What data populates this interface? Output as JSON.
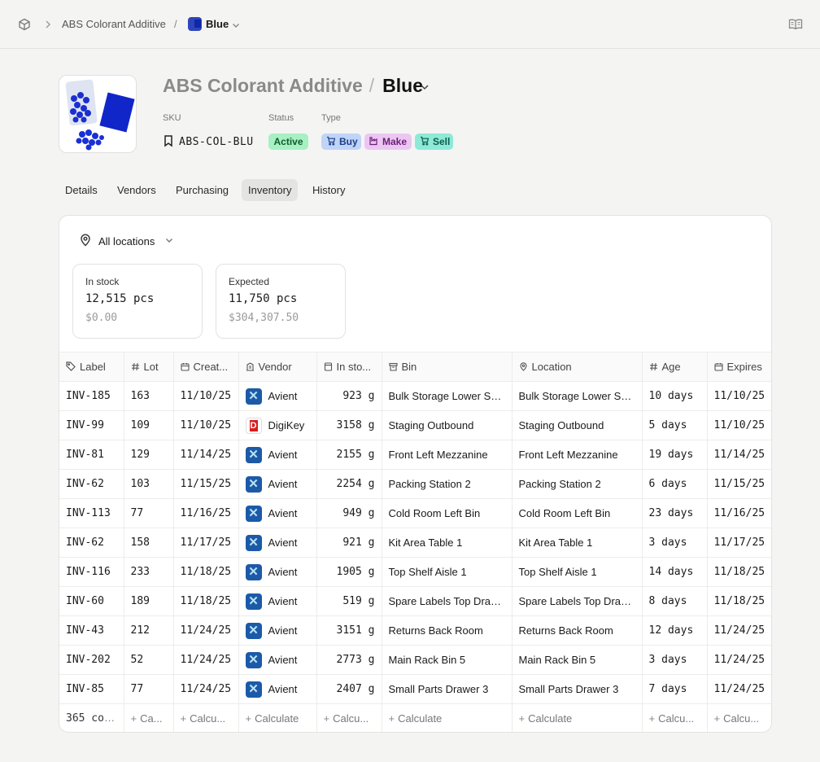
{
  "breadcrumb": {
    "item": "ABS Colorant Additive",
    "separator": "/",
    "variant": "Blue"
  },
  "header": {
    "parent_title": "ABS Colorant Additive",
    "separator": "/",
    "variant_title": "Blue",
    "sku_label": "SKU",
    "sku": "ABS-COL-BLU",
    "status_label": "Status",
    "status": "Active",
    "type_label": "Type",
    "types": [
      "Buy",
      "Make",
      "Sell"
    ]
  },
  "tabs": [
    "Details",
    "Vendors",
    "Purchasing",
    "Inventory",
    "History"
  ],
  "active_tab": "Inventory",
  "location_filter": "All locations",
  "stats": {
    "in_stock": {
      "label": "In stock",
      "qty": "12,515 pcs",
      "value": "$0.00"
    },
    "expected": {
      "label": "Expected",
      "qty": "11,750 pcs",
      "value": "$304,307.50"
    }
  },
  "table": {
    "columns": [
      "Label",
      "Lot",
      "Creat...",
      "Vendor",
      "In sto...",
      "Bin",
      "Location",
      "Age",
      "Expires"
    ],
    "rows": [
      [
        "INV-185",
        "163",
        "11/10/25",
        "Avient",
        "923 g",
        "Bulk Storage Lower Shelf",
        "Bulk Storage Lower Shelf",
        "10 days",
        "11/10/25"
      ],
      [
        "INV-99",
        "109",
        "11/10/25",
        "DigiKey",
        "3158 g",
        "Staging Outbound",
        "Staging Outbound",
        "5 days",
        "11/10/25"
      ],
      [
        "INV-81",
        "129",
        "11/14/25",
        "Avient",
        "2155 g",
        "Front Left Mezzanine",
        "Front Left Mezzanine",
        "19 days",
        "11/14/25"
      ],
      [
        "INV-62",
        "103",
        "11/15/25",
        "Avient",
        "2254 g",
        "Packing Station 2",
        "Packing Station 2",
        "6 days",
        "11/15/25"
      ],
      [
        "INV-113",
        "77",
        "11/16/25",
        "Avient",
        "949 g",
        "Cold Room Left Bin",
        "Cold Room Left Bin",
        "23 days",
        "11/16/25"
      ],
      [
        "INV-62",
        "158",
        "11/17/25",
        "Avient",
        "921 g",
        "Kit Area Table 1",
        "Kit Area Table 1",
        "3 days",
        "11/17/25"
      ],
      [
        "INV-116",
        "233",
        "11/18/25",
        "Avient",
        "1905 g",
        "Top Shelf Aisle 1",
        "Top Shelf Aisle 1",
        "14 days",
        "11/18/25"
      ],
      [
        "INV-60",
        "189",
        "11/18/25",
        "Avient",
        "519 g",
        "Spare Labels Top Drawer",
        "Spare Labels Top Drawer",
        "8 days",
        "11/18/25"
      ],
      [
        "INV-43",
        "212",
        "11/24/25",
        "Avient",
        "3151 g",
        "Returns Back Room",
        "Returns Back Room",
        "12 days",
        "11/24/25"
      ],
      [
        "INV-202",
        "52",
        "11/24/25",
        "Avient",
        "2773 g",
        "Main Rack Bin 5",
        "Main Rack Bin 5",
        "3 days",
        "11/24/25"
      ],
      [
        "INV-85",
        "77",
        "11/24/25",
        "Avient",
        "2407 g",
        "Small Parts Drawer 3",
        "Small Parts Drawer 3",
        "7 days",
        "11/24/25"
      ]
    ],
    "footer": [
      "365 co...",
      "Ca...",
      "Calcu...",
      "Calculate",
      "Calcu...",
      "Calculate",
      "Calculate",
      "Calcu...",
      "Calcu..."
    ]
  }
}
